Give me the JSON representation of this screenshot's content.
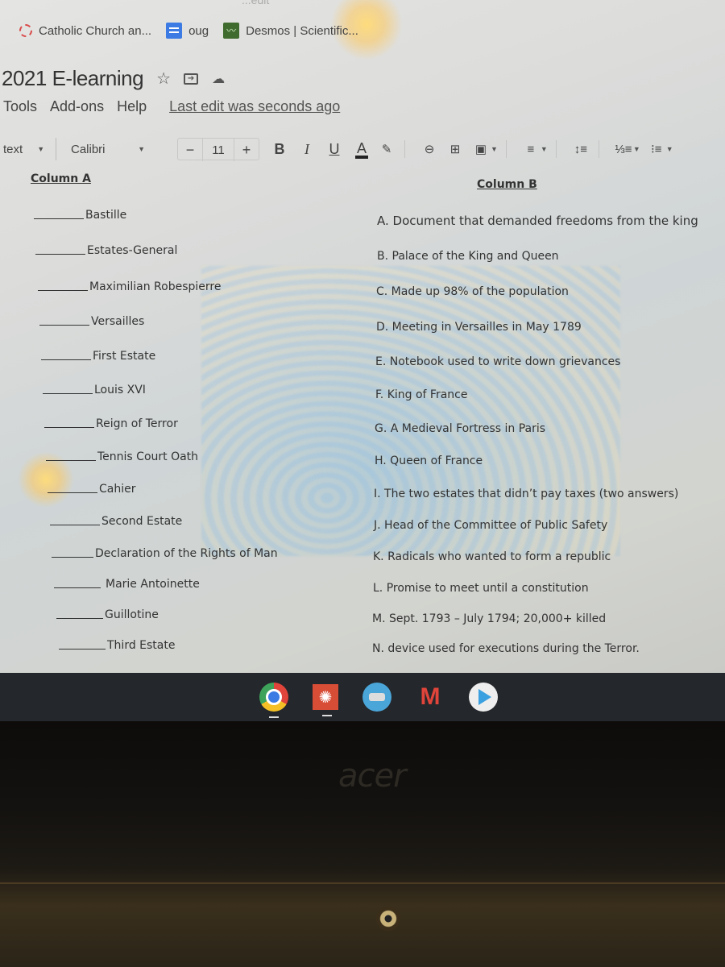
{
  "browser": {
    "url_remnant": "...edit",
    "bookmarks": [
      {
        "icon": "canvas-icon",
        "label": "Catholic Church an..."
      },
      {
        "icon": "google-docs-icon",
        "label": "oug"
      },
      {
        "icon": "desmos-icon",
        "label": "Desmos | Scientific..."
      }
    ]
  },
  "document": {
    "title": "2021 E-learning",
    "title_icons": [
      "star-icon",
      "move-to-folder-icon",
      "cloud-saved-icon"
    ],
    "menu": [
      "Tools",
      "Add-ons",
      "Help"
    ],
    "last_edit": "Last edit was seconds ago"
  },
  "toolbar": {
    "style_value": "text",
    "font_value": "Calibri",
    "font_size": "11",
    "decrease": "−",
    "increase": "+",
    "bold": "B",
    "italic": "I",
    "underline": "U",
    "text_color": "A",
    "icons": [
      "highlight-icon",
      "link-icon",
      "comment-icon",
      "image-icon",
      "align-icon",
      "line-spacing-icon",
      "numbered-list-icon",
      "bulleted-list-icon"
    ]
  },
  "worksheet": {
    "column_a_header": "Column A",
    "column_b_header": "Column B",
    "column_a": [
      "Bastille",
      "Estates-General",
      "Maximilian Robespierre",
      "Versailles",
      "First Estate",
      "Louis XVI",
      "Reign of Terror",
      "Tennis Court Oath",
      "Cahier",
      "Second Estate",
      "Declaration of the Rights of Man",
      "Marie Antoinette",
      "Guillotine",
      "Third Estate"
    ],
    "column_b": [
      "A. Document that demanded freedoms from the king",
      "B. Palace of the King and Queen",
      "C. Made up 98% of the population",
      "D. Meeting in Versailles in May 1789",
      "E. Notebook used to write down grievances",
      "F. King of France",
      "G. A Medieval Fortress in Paris",
      "H. Queen of France",
      "I. The two estates that didn’t pay taxes (two answers)",
      "J. Head of the Committee of Public Safety",
      "K. Radicals who wanted to form a republic",
      "L. Promise to meet until a constitution",
      "M. Sept. 1793 – July 1794; 20,000+ killed",
      "N. device used for executions during the Terror."
    ]
  },
  "shelf": {
    "apps": [
      "chrome-icon",
      "canvas-app-icon",
      "classroom-app-icon",
      "gmail-icon",
      "play-store-icon"
    ],
    "gmail_glyph": "M"
  },
  "laptop": {
    "brand": "acer"
  },
  "colors": {
    "screen_bg": "#dcdcda",
    "text": "#333333",
    "shelf_bg": "#24272b"
  }
}
